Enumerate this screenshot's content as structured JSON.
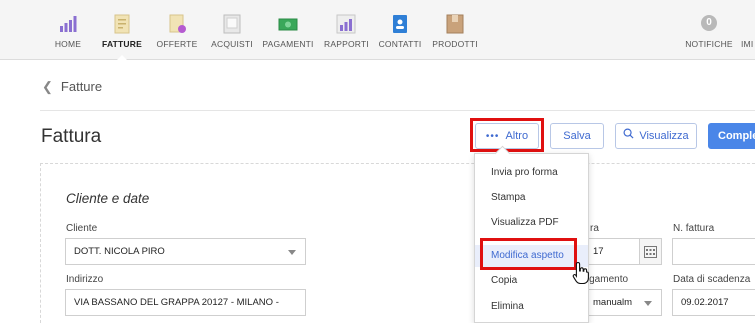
{
  "nav": {
    "items": [
      {
        "label": "HOME",
        "icon": "bar-chart-icon"
      },
      {
        "label": "FATTURE",
        "icon": "invoice-icon"
      },
      {
        "label": "OFFERTE",
        "icon": "offer-icon"
      },
      {
        "label": "ACQUISTI",
        "icon": "purchase-icon"
      },
      {
        "label": "PAGAMENTI",
        "icon": "banknote-icon"
      },
      {
        "label": "RAPPORTI",
        "icon": "report-icon"
      },
      {
        "label": "CONTATTI",
        "icon": "contact-book-icon"
      },
      {
        "label": "PRODOTTI",
        "icon": "product-box-icon"
      }
    ],
    "notifications_label": "NOTIFICHE",
    "notifications_count": "0",
    "cut_label": "IMI"
  },
  "breadcrumb": {
    "label": "Fatture"
  },
  "page": {
    "title": "Fattura"
  },
  "toolbar": {
    "more_dots": "•••",
    "more_label": "Altro",
    "save_label": "Salva",
    "preview_label": "Visualizza",
    "complete_label": "Complet"
  },
  "menu": {
    "items": [
      {
        "label": "Invia pro forma"
      },
      {
        "label": "Stampa"
      },
      {
        "label": "Visualizza PDF"
      },
      {
        "label": "Modifica aspetto"
      },
      {
        "label": "Copia"
      },
      {
        "label": "Elimina"
      }
    ]
  },
  "form": {
    "section_title": "Cliente e date",
    "cliente_label": "Cliente",
    "cliente_value": "DOTT. NICOLA PIRO",
    "indirizzo_label": "Indirizzo",
    "indirizzo_value": "VIA BASSANO DEL GRAPPA 20127 - MILANO -",
    "data_label_partial": "ra",
    "data_value_partial": "17",
    "nfattura_label": "N. fattura",
    "pagamento_label_partial": "pagamento",
    "pagamento_value_partial": "manualm",
    "scadenza_label": "Data di scadenza",
    "scadenza_value": "09.02.2017"
  },
  "colors": {
    "accent": "#4a86e8",
    "highlight": "#e01010",
    "link": "#3f6ad0"
  }
}
